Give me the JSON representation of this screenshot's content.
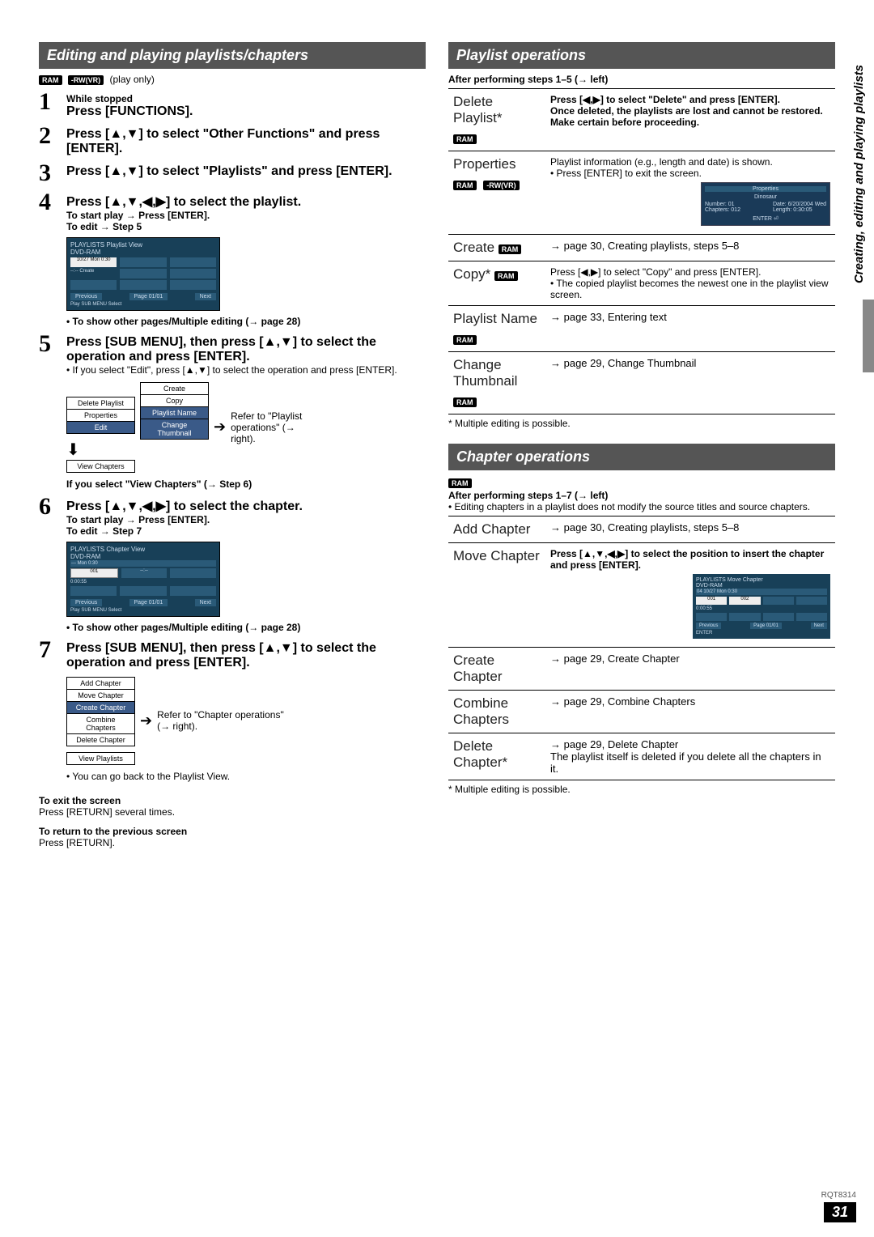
{
  "sideTab": "Creating, editing and playing playlists",
  "left": {
    "header": "Editing and playing playlists/chapters",
    "discBadges": [
      "RAM",
      "-RW(VR)"
    ],
    "discNote": " (play only)",
    "steps": {
      "s1": {
        "num": "1",
        "line1": "While stopped",
        "line2": "Press [FUNCTIONS]."
      },
      "s2": {
        "num": "2",
        "text": "Press [▲,▼] to select \"Other Functions\" and press [ENTER]."
      },
      "s3": {
        "num": "3",
        "text": "Press [▲,▼] to select \"Playlists\" and press [ENTER]."
      },
      "s4": {
        "num": "4",
        "text": "Press [▲,▼,◀,▶] to select the playlist.",
        "sub1": "To start play → Press [ENTER].",
        "sub2": "To edit → Step 5"
      },
      "s4note": "• To show other pages/Multiple editing (→ page 28)",
      "s5": {
        "num": "5",
        "text": "Press [SUB MENU], then press [▲,▼] to select the operation and press [ENTER].",
        "sub": "• If you select \"Edit\", press [▲,▼] to select the operation and press [ENTER]."
      },
      "s5menu": {
        "left": [
          "Delete Playlist",
          "Properties",
          "Edit",
          "View Chapters"
        ],
        "right": [
          "Create",
          "Copy",
          "Playlist Name",
          "Change Thumbnail"
        ],
        "ref": "Refer to \"Playlist operations\" (→ right)."
      },
      "s5note": "If you select \"View Chapters\" (→ Step 6)",
      "s6": {
        "num": "6",
        "text": "Press [▲,▼,◀,▶] to select the chapter.",
        "sub1": "To start play → Press [ENTER].",
        "sub2": "To edit → Step 7"
      },
      "s6note": "• To show other pages/Multiple editing (→ page 28)",
      "s7": {
        "num": "7",
        "text": "Press [SUB MENU], then press [▲,▼] to select the operation and press [ENTER]."
      },
      "s7menu": {
        "items": [
          "Add Chapter",
          "Move Chapter",
          "Create Chapter",
          "Combine Chapters",
          "Delete Chapter",
          "View Playlists"
        ],
        "ref": "Refer to \"Chapter operations\" (→ right).",
        "back": "• You can go back to the Playlist View."
      }
    },
    "exit": {
      "h": "To exit the screen",
      "t": "Press [RETURN] several times."
    },
    "ret": {
      "h": "To return to the previous screen",
      "t": "Press [RETURN]."
    },
    "scrn1": {
      "title": "PLAYLISTS     Playlist View",
      "sub": "DVD-RAM",
      "date": "10/27 Mon 0:30",
      "btnPrev": "Previous",
      "btnPage": "Page   01/01",
      "btnNext": "Next",
      "foot": "Play     SUB MENU    Select"
    },
    "scrn2": {
      "title": "PLAYLISTS     Chapter View",
      "sub": "DVD-RAM",
      "row1": "001",
      "t1": "0:00:55",
      "t2": "--:--",
      "btnPrev": "Previous",
      "btnPage": "Page   01/01",
      "btnNext": "Next",
      "foot": "Play     SUB MENU    Select"
    }
  },
  "right": {
    "plHeader": "Playlist operations",
    "plPre": "After performing steps 1–5 (→ left)",
    "plRows": {
      "del": {
        "t": "Delete Playlist*",
        "badge": "RAM",
        "d": "Press [◀,▶] to select \"Delete\" and press [ENTER].\nOnce deleted, the playlists are lost and cannot be restored.\nMake certain before proceeding."
      },
      "prop": {
        "t": "Properties",
        "badges": [
          "RAM",
          "-RW(VR)"
        ],
        "d": "Playlist information (e.g., length and date) is shown.\n• Press [ENTER] to exit the screen.",
        "box": {
          "title": "Properties",
          "name": "Dinosaur",
          "l1": "Number:   01",
          "l2": "Chapters:  012",
          "r1": "Date: 6/20/2004 Wed",
          "r2": "Length: 0:30:05"
        }
      },
      "create": {
        "t": "Create",
        "badge": "RAM",
        "d": "→ page 30, Creating playlists, steps 5–8"
      },
      "copy": {
        "t": "Copy*",
        "badge": "RAM",
        "d": "Press [◀,▶] to select \"Copy\" and press [ENTER].\n• The copied playlist becomes the newest one in the playlist view screen."
      },
      "name": {
        "t": "Playlist Name",
        "badge": "RAM",
        "d": "→ page 33, Entering text"
      },
      "thumb": {
        "t": "Change Thumbnail",
        "badge": "RAM",
        "d": "→ page 29, Change Thumbnail"
      }
    },
    "plFoot": "* Multiple editing is possible.",
    "chHeader": "Chapter operations",
    "chBadge": "RAM",
    "chPre": "After performing steps 1–7 (→ left)",
    "chNote": "• Editing chapters in a playlist does not modify the source titles and source chapters.",
    "chRows": {
      "add": {
        "t": "Add Chapter",
        "d": "→ page 30, Creating playlists, steps 5–8"
      },
      "move": {
        "t": "Move Chapter",
        "d": "Press [▲,▼,◀,▶] to select the position to insert the chapter and press [ENTER].",
        "scrn": {
          "title": "PLAYLISTS      Move Chapter",
          "sub": "DVD-RAM",
          "row": "04 10/27 Mon 0:30",
          "cell": "001",
          "t": "0:00:55",
          "btnPrev": "Previous",
          "btnPage": "Page   01/01",
          "btnNext": "Next",
          "foot": "ENTER"
        }
      },
      "create": {
        "t": "Create Chapter",
        "d": "→ page 29, Create Chapter"
      },
      "combine": {
        "t": "Combine Chapters",
        "d": "→ page 29, Combine Chapters"
      },
      "del": {
        "t": "Delete Chapter*",
        "d": "→ page 29, Delete Chapter\nThe playlist itself is deleted if you delete all the chapters in it."
      }
    },
    "chFoot": "* Multiple editing is possible."
  },
  "footer": {
    "code": "RQT8314",
    "page": "31"
  }
}
